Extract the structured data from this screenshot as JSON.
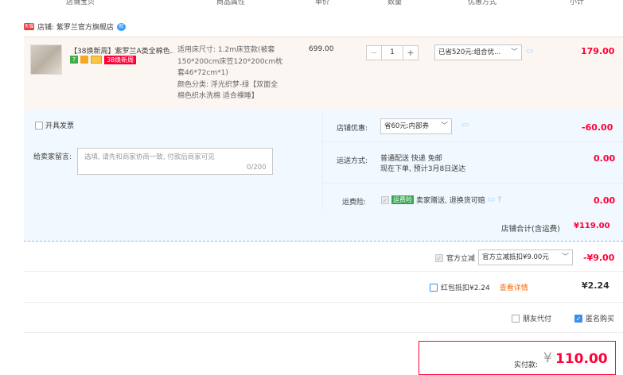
{
  "header": {
    "col_info": "店铺宝贝",
    "col_attr": "商品属性",
    "col_price": "单价",
    "col_qty": "数量",
    "col_promo": "优惠方式",
    "col_subtotal": "小计"
  },
  "shop": {
    "badge": "天猫",
    "name": "店铺: 紫罗兰官方旗舰店",
    "chat": "旺"
  },
  "item": {
    "title": "【38焕新周】紫罗兰A类全棉色...",
    "badge_7": "7",
    "badge_event": "38焕新周",
    "spec_line1": "适用床尺寸: 1.2m床笠款(被套",
    "spec_line2": "150*200cm床笠120*200cm枕",
    "spec_line3": "套46*72cm*1)",
    "spec_line4": "颜色分类: 浮光织梦-绿【双面全",
    "spec_line5": "棉色织水洗棉 适合裸睡】",
    "price": "699.00",
    "qty_minus": "−",
    "qty_value": "1",
    "qty_plus": "+",
    "promo_select": "已省520元:组合优...",
    "subtotal": "179.00"
  },
  "invoice": {
    "label": "开具发票"
  },
  "shop_discount": {
    "label": "店铺优惠:",
    "select": "省60元:内部券",
    "amount": "-60.00"
  },
  "memo": {
    "label": "给卖家留言:",
    "placeholder": "选填, 请先和商家协商一致, 付款后商家可见",
    "count": "0/200"
  },
  "shipping": {
    "label": "运送方式:",
    "line1": "普通配送 快递 免邮",
    "line2": "现在下单, 预计3月8日送达",
    "amount": "0.00"
  },
  "insurance": {
    "label": "运费险:",
    "tag": "运费险",
    "text": "卖家赠送, 退换货可赔",
    "amount": "0.00"
  },
  "shop_total": {
    "label": "店铺合计(含运费)",
    "amount": "¥119.00"
  },
  "official_discount": {
    "label": "官方立减",
    "select": "官方立减抵扣¥9.00元",
    "amount": "-¥9.00"
  },
  "red_packet": {
    "label": "红包抵扣¥2.24",
    "link": "查看详情",
    "amount": "¥2.24"
  },
  "options": {
    "friend_pay": "朋友代付",
    "anonymous": "匿名购买"
  },
  "payment": {
    "label": "实付款:",
    "currency": "¥",
    "amount": "110.00"
  },
  "colors": {
    "accent_red": "#ff0036",
    "link_orange": "#ff6600",
    "panel_blue": "#f2f8ff",
    "checkbox_blue": "#3d8ee8"
  }
}
